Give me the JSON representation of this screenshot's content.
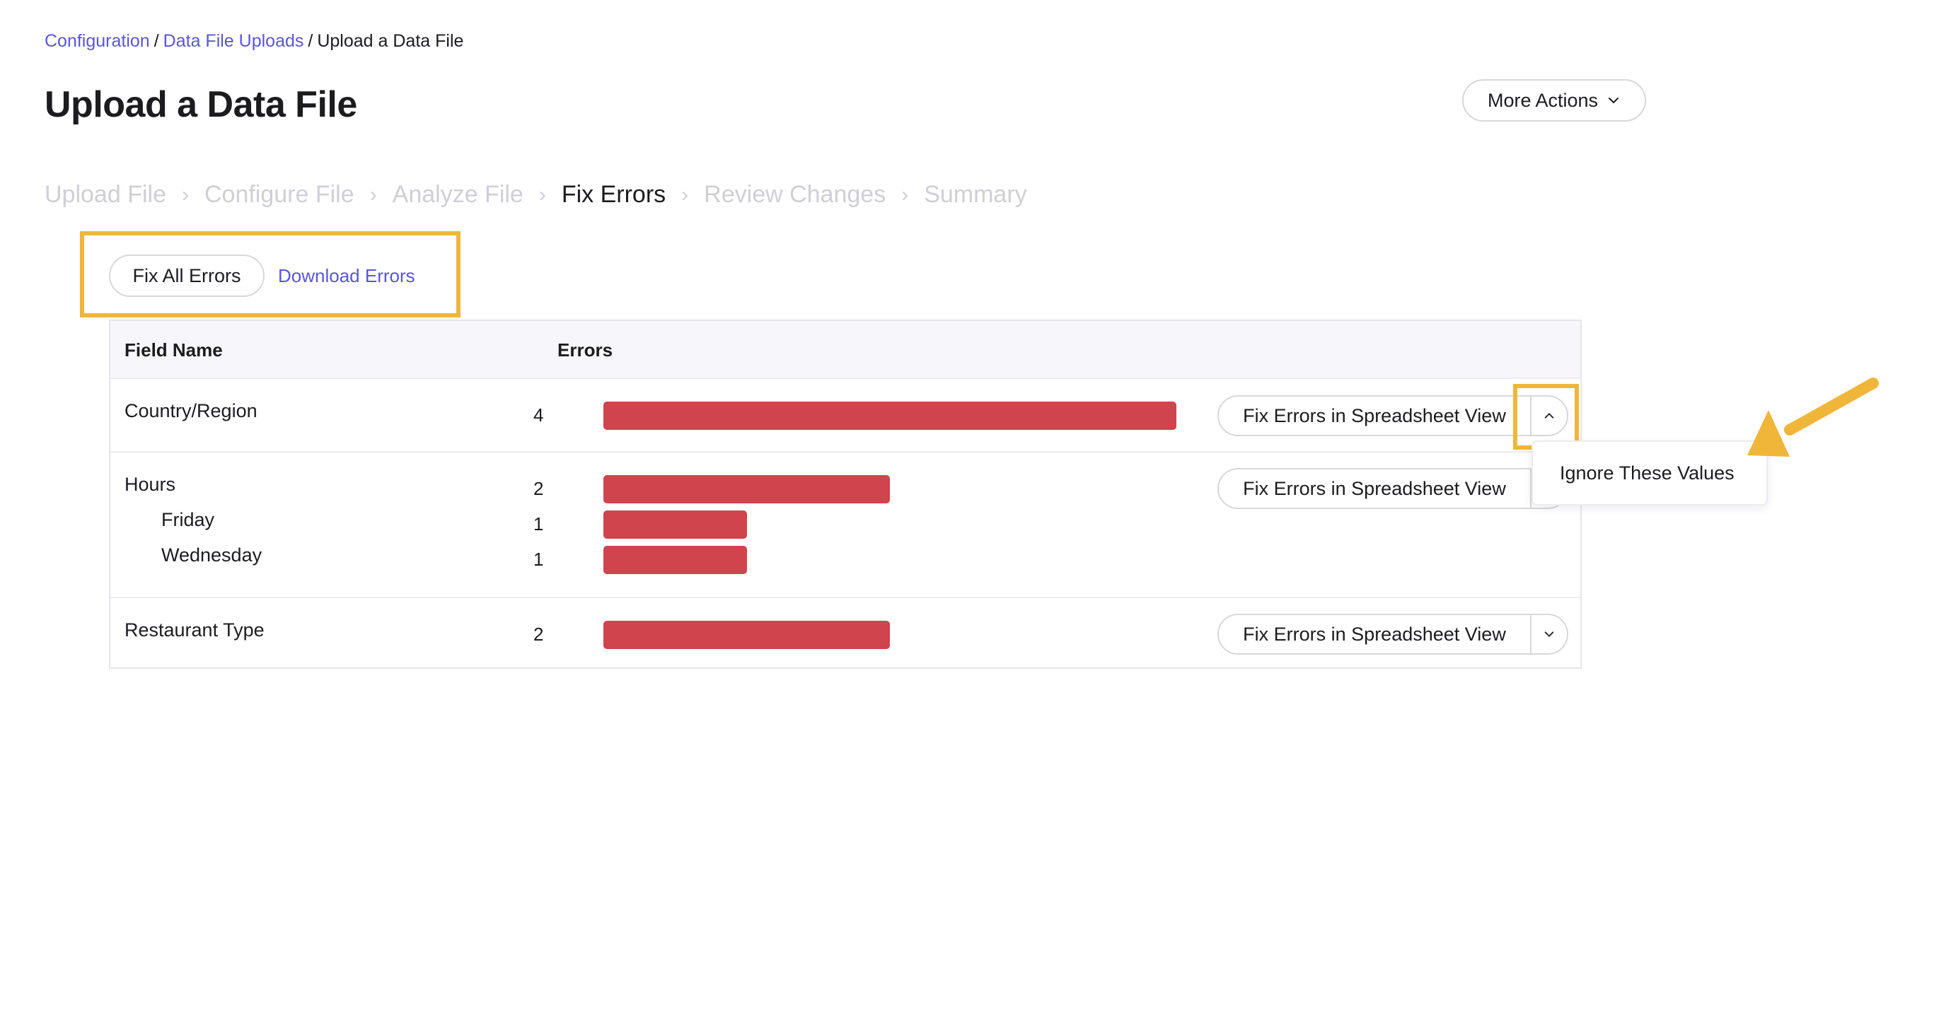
{
  "breadcrumb": {
    "items": [
      "Configuration",
      "Data File Uploads"
    ],
    "separator": "/",
    "current": "Upload a Data File"
  },
  "page": {
    "title": "Upload a Data File"
  },
  "more_actions": {
    "label": "More Actions",
    "icon": "chevron-down-icon"
  },
  "steps": {
    "items": [
      "Upload File",
      "Configure File",
      "Analyze File",
      "Fix Errors",
      "Review Changes",
      "Summary"
    ],
    "active": "Fix Errors",
    "separator": "›"
  },
  "actions": {
    "fix_all_label": "Fix All Errors",
    "download_label": "Download Errors"
  },
  "table": {
    "headers": {
      "field_name": "Field Name",
      "errors": "Errors"
    },
    "rows": [
      {
        "field": "Country/Region",
        "count": "4",
        "fraction": 1.0,
        "button_label": "Fix Errors in Spreadsheet View",
        "toggle_icon": "chevron-up-icon",
        "sub_rows": []
      },
      {
        "field": "Hours",
        "count": "2",
        "fraction": 0.5,
        "button_label": "Fix Errors in Spreadsheet View",
        "toggle_icon": "chevron-down-icon",
        "sub_rows": [
          {
            "field": "Friday",
            "count": "1",
            "fraction": 0.25
          },
          {
            "field": "Wednesday",
            "count": "1",
            "fraction": 0.25
          }
        ]
      },
      {
        "field": "Restaurant Type",
        "count": "2",
        "fraction": 0.5,
        "button_label": "Fix Errors in Spreadsheet View",
        "toggle_icon": "chevron-down-icon",
        "sub_rows": []
      }
    ]
  },
  "dropdown": {
    "items": [
      "Ignore These Values"
    ]
  },
  "colors": {
    "accent_link": "#5a56d6",
    "error_bar": "#cf444d",
    "highlight": "#f0b63a",
    "header_bg": "#f7f7fb",
    "step_inactive": "#cfcfd4"
  }
}
